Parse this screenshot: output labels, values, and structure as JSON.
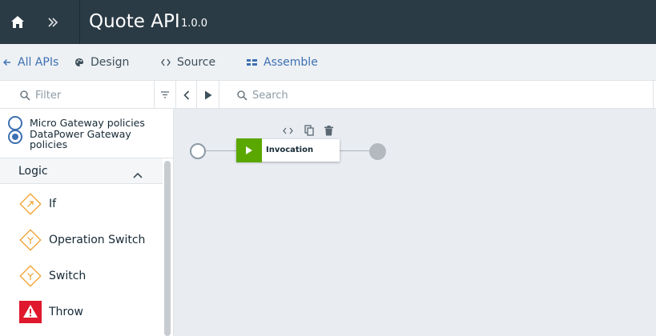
{
  "header": {
    "title": "Quote API",
    "version": "1.0.0",
    "home_icon": "home-icon",
    "expand_icon": "double-chevron-right-icon",
    "background": "#2b3b45"
  },
  "tabs": [
    {
      "label": "All APIs",
      "icon": "arrow-left-icon"
    },
    {
      "label": "Design",
      "icon": "palette-icon"
    },
    {
      "label": "Source",
      "icon": "code-icon"
    },
    {
      "label": "Assemble",
      "icon": "assemble-icon",
      "active": true
    }
  ],
  "toolbar": {
    "filter_placeholder": "Filter",
    "search_placeholder": "Search"
  },
  "palette": {
    "gateway_options": [
      {
        "label": "Micro Gateway policies",
        "selected": false
      },
      {
        "label": "DataPower Gateway policies",
        "selected": true
      }
    ],
    "section_title": "Logic",
    "items": [
      {
        "label": "If",
        "icon": "if-diamond-icon"
      },
      {
        "label": "Operation Switch",
        "icon": "operation-switch-diamond-icon"
      },
      {
        "label": "Switch",
        "icon": "switch-diamond-icon"
      },
      {
        "label": "Throw",
        "icon": "throw-warning-icon"
      }
    ]
  },
  "canvas": {
    "node_label": "Invocation",
    "node_color": "#5aa700"
  },
  "colors": {
    "accent": "#3d70b2",
    "logic_icon": "#f0a030",
    "throw_icon": "#e0182d"
  }
}
